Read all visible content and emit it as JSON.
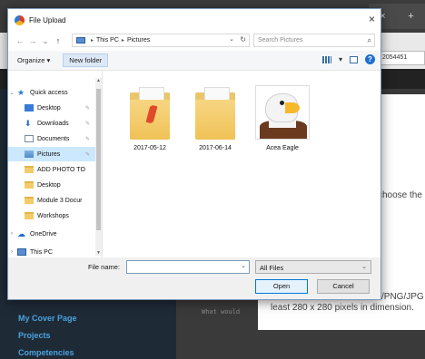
{
  "background": {
    "tab_close": "×",
    "tab_new": "+",
    "address_fragment": "2054451",
    "choose_text": "choose the",
    "format_text": "/PNG/JPG",
    "size_text": "least 280 x 280 pixels in dimension.",
    "what_text": "What would",
    "nav_links": [
      "My Cover Page",
      "Projects",
      "Competencies"
    ]
  },
  "dialog": {
    "title": "File Upload",
    "close": "×",
    "nav": {
      "back": "←",
      "forward": "→",
      "recent": "⌄",
      "up": "↑"
    },
    "breadcrumb": [
      "This PC",
      "Pictures"
    ],
    "search_placeholder": "Search Pictures",
    "toolbar": {
      "organize": "Organize ▾",
      "new_folder": "New folder"
    },
    "tree": [
      {
        "label": "Quick access",
        "icon": "star-icon",
        "pinned": false
      },
      {
        "label": "Desktop",
        "icon": "desktop-icon",
        "pinned": true
      },
      {
        "label": "Downloads",
        "icon": "downloads-icon",
        "pinned": true
      },
      {
        "label": "Documents",
        "icon": "documents-icon",
        "pinned": true
      },
      {
        "label": "Pictures",
        "icon": "pictures-icon",
        "pinned": true,
        "selected": true
      },
      {
        "label": "ADD PHOTO TO",
        "icon": "folder-icon",
        "pinned": false
      },
      {
        "label": "Desktop",
        "icon": "folder-icon",
        "pinned": false
      },
      {
        "label": "Module 3 Docur",
        "icon": "folder-icon",
        "pinned": false
      },
      {
        "label": "Workshops",
        "icon": "folder-icon",
        "pinned": false
      },
      {
        "label": "OneDrive",
        "icon": "onedrive-icon",
        "pinned": false
      },
      {
        "label": "This PC",
        "icon": "this-pc-icon",
        "pinned": false
      }
    ],
    "files": [
      {
        "name": "2017-05-12",
        "type": "folder"
      },
      {
        "name": "2017-06-14",
        "type": "folder"
      },
      {
        "name": "Acea Eagle",
        "type": "image"
      }
    ],
    "file_name_label": "File name:",
    "file_name_value": "",
    "file_type": "All Files",
    "open_label": "Open",
    "cancel_label": "Cancel"
  }
}
